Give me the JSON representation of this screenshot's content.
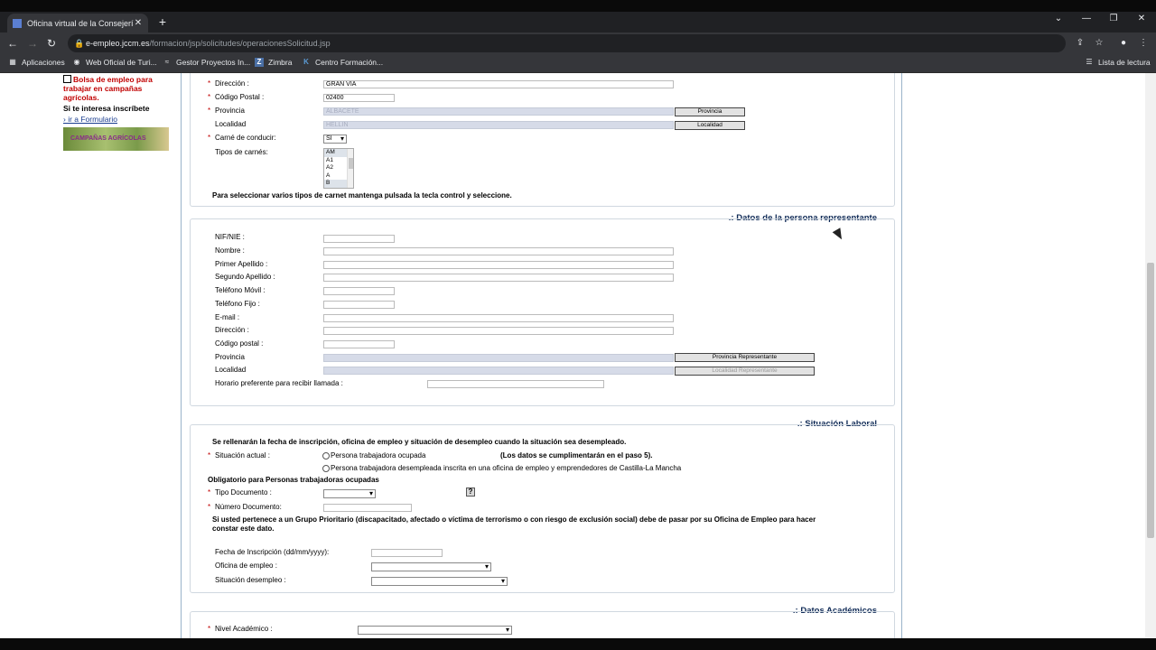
{
  "browser": {
    "tab_title": "Oficina virtual de la Consejería de",
    "tab_close": "✕",
    "new_tab": "+",
    "url_host": "e-empleo.jccm.es",
    "url_path": "/formacion/jsp/solicitudes/operacionesSolicitud.jsp",
    "window_controls": {
      "tabsearch": "⌄",
      "minimize": "—",
      "restore": "❐",
      "close": "✕"
    },
    "nav": {
      "back": "←",
      "forward": "→",
      "reload": "↻"
    },
    "toolbar_icons": {
      "share": "⇪",
      "star": "☆",
      "profile": "●",
      "menu": "⋮"
    }
  },
  "bookmarks": [
    {
      "icon": "apps-icon",
      "label": "Aplicaciones"
    },
    {
      "icon": "globe-icon",
      "label": "Web Oficial de Turi..."
    },
    {
      "icon": "gestor-icon",
      "label": "Gestor Proyectos In..."
    },
    {
      "icon": "zimbra-icon",
      "label": "Zimbra"
    },
    {
      "icon": "k-icon",
      "label": "Centro Formación..."
    }
  ],
  "reading_list": "Lista de lectura",
  "promo": {
    "link": "Bolsa de empleo para trabajar en campañas agrícolas.",
    "note": "Si te interesa inscríbete",
    "form_link": "› ir a Formulario",
    "banner_text": "CAMPAÑAS AGRÍCOLAS"
  },
  "address_section": {
    "fields": [
      {
        "label": "Dirección",
        "value": "GRAN VIA",
        "required": true
      },
      {
        "label": "Código Postal",
        "value": "02400",
        "required": true
      },
      {
        "label": "Provincia",
        "value": "ALBACETE",
        "required": true,
        "button": "Provincia"
      },
      {
        "label": "Localidad",
        "value": "HELLIN",
        "required": false,
        "button": "Localidad"
      },
      {
        "label": "Carné de conducir:",
        "value": "SI",
        "required": true
      }
    ],
    "tipos_label": "Tipos de carnés:",
    "tipos_options": [
      "AM",
      "A1",
      "A2",
      "A",
      "B"
    ],
    "tipos_selected": [
      "AM",
      "B"
    ],
    "hint": "Para seleccionar varios tipos de carnet mantenga pulsada la tecla control y seleccione."
  },
  "representante": {
    "title": ".: Datos de la persona representante",
    "labels": [
      "NIF/NIE :",
      "Nombre :",
      "Primer Apellido :",
      "Segundo Apellido :",
      "Teléfono Móvil :",
      "Teléfono Fijo :",
      "E-mail :",
      "Dirección :",
      "Código postal :",
      "Provincia",
      "Localidad",
      "Horario preferente para recibir llamada :"
    ],
    "btn_provincia": "Provincia Representante",
    "btn_localidad": "Localidad Representante"
  },
  "laboral": {
    "title": ".: Situación Laboral",
    "intro": "Se rellenarán la fecha de inscripción, oficina de empleo y situación de desempleo cuando la situación sea desempleado.",
    "situacion_label": "Situación actual :",
    "opt1": "Persona trabajadora ocupada",
    "opt1_note": "(Los datos se cumplimentarán en el paso 5).",
    "opt2": "Persona trabajadora desempleada inscrita en una oficina de empleo y emprendedores de Castilla-La Mancha",
    "obligatorio": "Obligatorio para Personas trabajadoras ocupadas",
    "tipo_doc": "Tipo Documento :",
    "help": "?",
    "num_doc": "Número Documento:",
    "prioritario": "Si usted pertenece a un Grupo Prioritario (discapacitado, afectado o víctima de terrorismo o con riesgo de exclusión social) debe de pasar por su Oficina de Empleo para hacer constar este dato.",
    "fecha": "Fecha de Inscripción (dd/mm/yyyy):",
    "oficina": "Oficina de empleo :",
    "desempleo": "Situación desempleo :"
  },
  "academicos": {
    "title": ".: Datos Académicos",
    "nivel": "Nivel Académico :"
  },
  "colors": {
    "accent": "#0f2a56",
    "required": "#c00000",
    "disabled_field": "#d6dbe8"
  }
}
